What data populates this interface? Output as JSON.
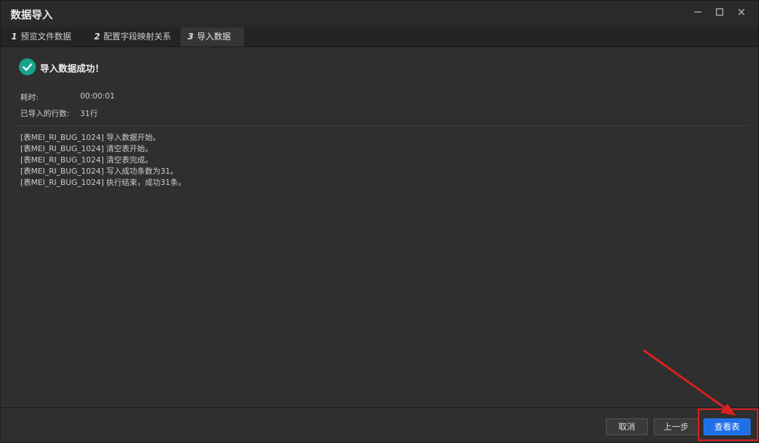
{
  "window": {
    "title": "数据导入",
    "controls": {
      "minimize_icon": "minimize-icon",
      "maximize_icon": "maximize-icon",
      "close_icon": "close-icon"
    }
  },
  "tabs": [
    {
      "num": "1",
      "label": "预览文件数据",
      "active": false
    },
    {
      "num": "2",
      "label": "配置字段映射关系",
      "active": false
    },
    {
      "num": "3",
      "label": "导入数据",
      "active": true
    }
  ],
  "result": {
    "status_text": "导入数据成功！",
    "status_icon": "check-circle-icon",
    "status_color": "#17a38a",
    "elapsed_label": "耗时:",
    "elapsed_value": "00:00:01",
    "rows_label": "已导入的行数:",
    "rows_value": "31行"
  },
  "log": [
    "[表MEI_RI_BUG_1024] 导入数据开始。",
    "[表MEI_RI_BUG_1024] 清空表开始。",
    "[表MEI_RI_BUG_1024] 清空表完成。",
    "[表MEI_RI_BUG_1024] 写入成功条数为31。",
    "[表MEI_RI_BUG_1024] 执行结束，成功31条。"
  ],
  "footer": {
    "cancel_label": "取消",
    "prev_label": "上一步",
    "view_table_label": "查看表",
    "primary_color": "#1f6fe6"
  },
  "annotation": {
    "highlight_color": "#e02020"
  }
}
